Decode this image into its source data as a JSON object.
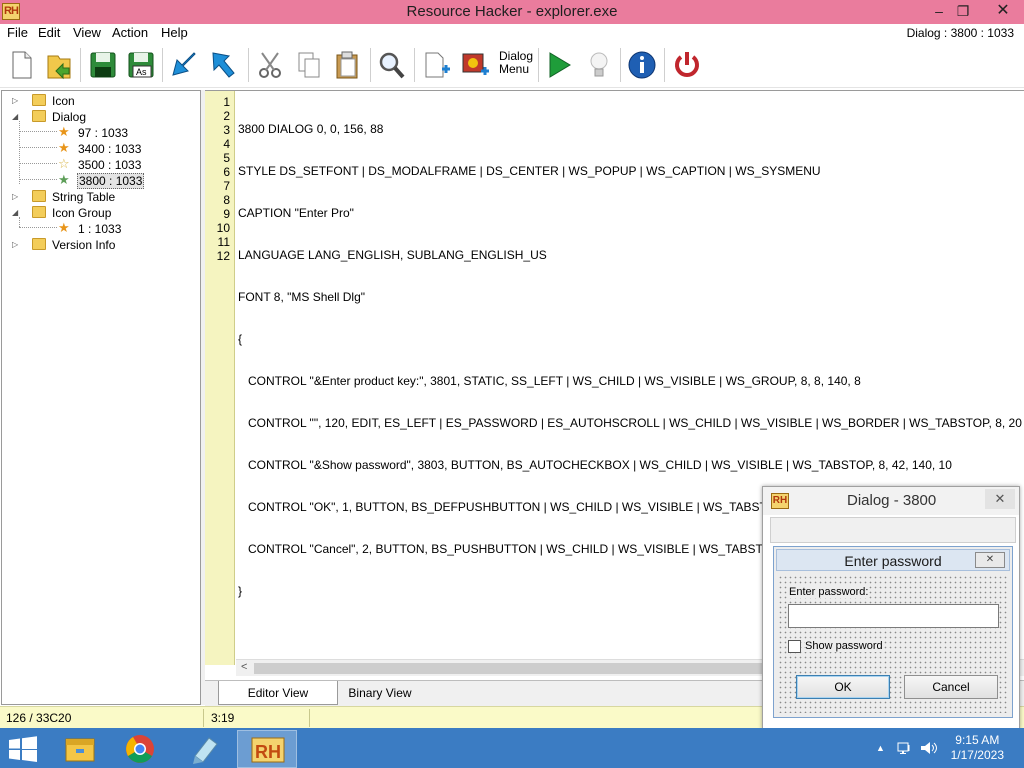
{
  "window": {
    "title": "Resource Hacker - explorer.exe",
    "app_icon_text": "RH",
    "minimize": "–",
    "maximize": "❐",
    "close": "✕"
  },
  "menu": {
    "items": [
      "File",
      "Edit",
      "View",
      "Action",
      "Help"
    ],
    "current_resource": "Dialog : 3800 : 1033"
  },
  "toolbar": {
    "dialog_menu_line1": "Dialog",
    "dialog_menu_line2": "Menu"
  },
  "tree": {
    "nodes": [
      {
        "label": "Icon",
        "type": "folder",
        "expand": "▷"
      },
      {
        "label": "Dialog",
        "type": "folder",
        "expand": "◢"
      },
      {
        "label": "97 : 1033",
        "type": "star-orange"
      },
      {
        "label": "3400 : 1033",
        "type": "star-orange"
      },
      {
        "label": "3500 : 1033",
        "type": "star-empty"
      },
      {
        "label": "3800 : 1033",
        "type": "star-green",
        "selected": true
      },
      {
        "label": "String Table",
        "type": "folder",
        "expand": "▷"
      },
      {
        "label": "Icon Group",
        "type": "folder",
        "expand": "◢"
      },
      {
        "label": "1 : 1033",
        "type": "star-orange"
      },
      {
        "label": "Version Info",
        "type": "folder",
        "expand": "▷"
      }
    ]
  },
  "editor": {
    "line_numbers": [
      "1",
      "2",
      "3",
      "4",
      "5",
      "6",
      "7",
      "8",
      "9",
      "10",
      "11",
      "12"
    ],
    "lines": [
      "3800 DIALOG 0, 0, 156, 88",
      "STYLE DS_SETFONT | DS_MODALFRAME | DS_CENTER | WS_POPUP | WS_CAPTION | WS_SYSMENU",
      "CAPTION \"Enter Pro\"",
      "LANGUAGE LANG_ENGLISH, SUBLANG_ENGLISH_US",
      "FONT 8, \"MS Shell Dlg\"",
      "{",
      "   CONTROL \"&Enter product key:\", 3801, STATIC, SS_LEFT | WS_CHILD | WS_VISIBLE | WS_GROUP, 8, 8, 140, 8",
      "   CONTROL \"\", 120, EDIT, ES_LEFT | ES_PASSWORD | ES_AUTOHSCROLL | WS_CHILD | WS_VISIBLE | WS_BORDER | WS_TABSTOP, 8, 20",
      "   CONTROL \"&Show password\", 3803, BUTTON, BS_AUTOCHECKBOX | WS_CHILD | WS_VISIBLE | WS_TABSTOP, 8, 42, 140, 10",
      "   CONTROL \"OK\", 1, BUTTON, BS_DEFPUSHBUTTON | WS_CHILD | WS_VISIBLE | WS_TABSTOP, 12, 64, 64, 16",
      "   CONTROL \"Cancel\", 2, BUTTON, BS_PUSHBUTTON | WS_CHILD | WS_VISIBLE | WS_TABSTOP, 84, 64, 64, 16",
      "}"
    ],
    "scroll_left": "<"
  },
  "tabs": {
    "editor_view": "Editor View",
    "binary_view": "Binary View"
  },
  "status": {
    "left": "126 / 33C20",
    "position": "3:19"
  },
  "preview_dialog": {
    "window_title": "Dialog - 3800",
    "icon_text": "RH",
    "close": "✕",
    "inner_title": "Enter password",
    "inner_close": "✕",
    "label": "Enter password:",
    "password_value": "",
    "checkbox_label": "Show password",
    "ok": "OK",
    "cancel": "Cancel"
  },
  "taskbar": {
    "time": "9:15 AM",
    "date": "1/17/2023",
    "rh_text": "RH",
    "tray_up": "▲"
  },
  "colors": {
    "titlebar": "#ea7c9d",
    "gutter": "#f5f4c0",
    "statusbar": "#fafac8",
    "taskbar": "#3b7cc3"
  }
}
